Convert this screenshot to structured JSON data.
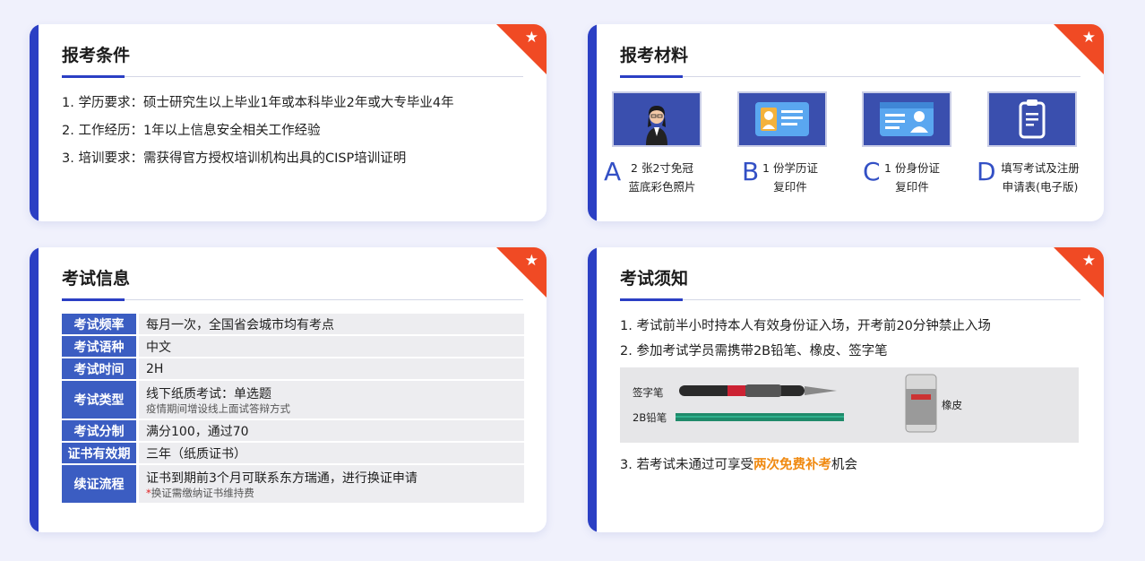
{
  "conditions": {
    "title": "报考条件",
    "items": [
      "1. 学历要求：硕士研究生以上毕业1年或本科毕业2年或大专毕业4年",
      "2. 工作经历：1年以上信息安全相关工作经验",
      "3. 培训要求：需获得官方授权培训机构出具的CISP培训证明"
    ]
  },
  "materials": {
    "title": "报考材料",
    "items": [
      {
        "letter": "A",
        "line1": "2 张2寸免冠",
        "line2": "蓝底彩色照片",
        "icon": "person-photo-icon"
      },
      {
        "letter": "B",
        "line1": "1 份学历证",
        "line2": "复印件",
        "icon": "diploma-card-icon"
      },
      {
        "letter": "C",
        "line1": "1 份身份证",
        "line2": "复印件",
        "icon": "id-card-icon"
      },
      {
        "letter": "D",
        "line1": "填写考试及注册",
        "line2": "申请表(电子版)",
        "icon": "clipboard-icon"
      }
    ]
  },
  "exam_info": {
    "title": "考试信息",
    "rows": [
      {
        "key": "考试频率",
        "value": "每月一次，全国省会城市均有考点",
        "sub": ""
      },
      {
        "key": "考试语种",
        "value": "中文",
        "sub": ""
      },
      {
        "key": "考试时间",
        "value": "2H",
        "sub": ""
      },
      {
        "key": "考试类型",
        "value": "线下纸质考试：单选题",
        "sub": "疫情期间增设线上面试答辩方式"
      },
      {
        "key": "考试分制",
        "value": "满分100，通过70",
        "sub": ""
      },
      {
        "key": "证书有效期",
        "value": "三年（纸质证书）",
        "sub": ""
      },
      {
        "key": "续证流程",
        "value": "证书到期前3个月可联系东方瑞通，进行换证申请",
        "sub": "换证需缴纳证书维持费",
        "sub_mark": "*"
      }
    ]
  },
  "notice": {
    "title": "考试须知",
    "items": [
      "1. 考试前半小时持本人有效身份证入场，开考前20分钟禁止入场",
      "2. 参加考试学员需携带2B铅笔、橡皮、签字笔"
    ],
    "photo_labels": {
      "pen": "签字笔",
      "pencil": "2B铅笔",
      "eraser": "橡皮"
    },
    "item3_prefix": "3. 若考试未通过可享受",
    "item3_highlight": "两次免费补考",
    "item3_suffix": "机会"
  },
  "colors": {
    "accent": "#2b3fc4",
    "corner": "#f04a24",
    "highlight": "#f08a12",
    "table_key": "#3b5dc2"
  }
}
